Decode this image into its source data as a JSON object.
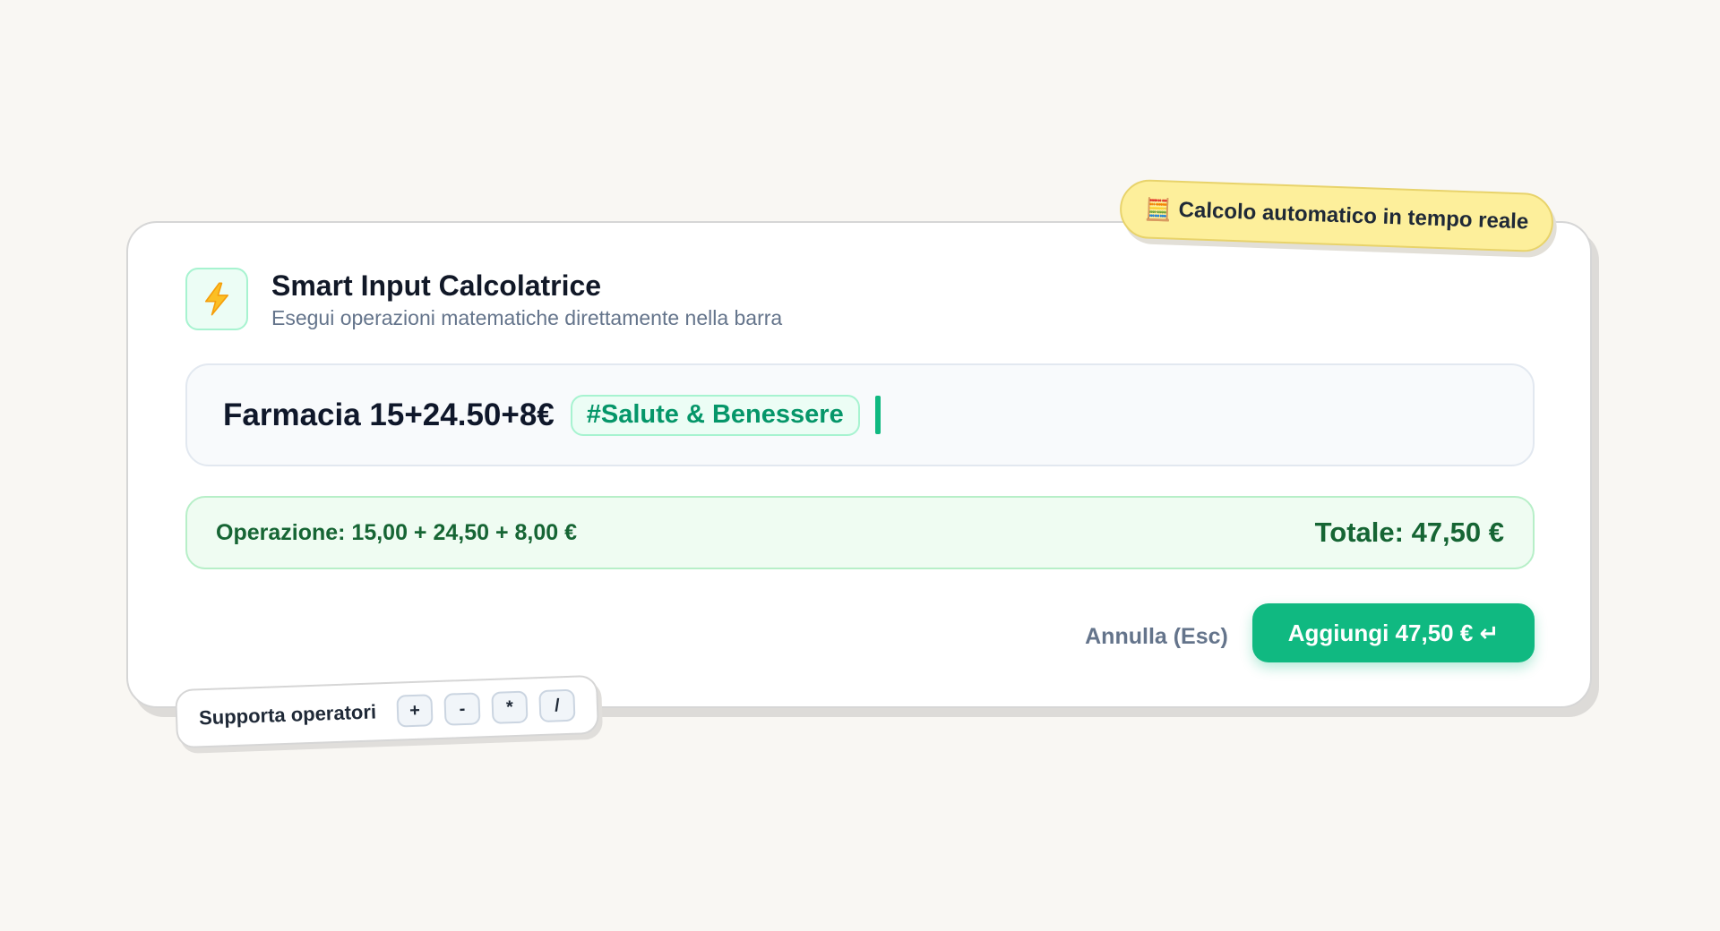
{
  "badge": {
    "icon": "abacus-icon",
    "icon_glyph": "🧮",
    "text": "Calcolo automatico in tempo reale",
    "color": "#fdef9b"
  },
  "header": {
    "icon": "lightning-bolt-icon",
    "title": "Smart Input Calcolatrice",
    "subtitle": "Esegui operazioni matematiche direttamente nella barra"
  },
  "input": {
    "value": "Farmacia 15+24.50+8€",
    "tag": "#Salute & Benessere"
  },
  "result": {
    "operation": "Operazione: 15,00 + 24,50 + 8,00 €",
    "total": "Totale: 47,50 €"
  },
  "actions": {
    "cancel_label": "Annulla (Esc)",
    "add_label": "Aggiungi 47,50 € ↵"
  },
  "hint": {
    "label": "Supporta operatori",
    "operators": [
      "+",
      "-",
      "*",
      "/"
    ]
  },
  "colors": {
    "accent": "#10b981",
    "success_text": "#166534",
    "background": "#f9f7f3"
  }
}
